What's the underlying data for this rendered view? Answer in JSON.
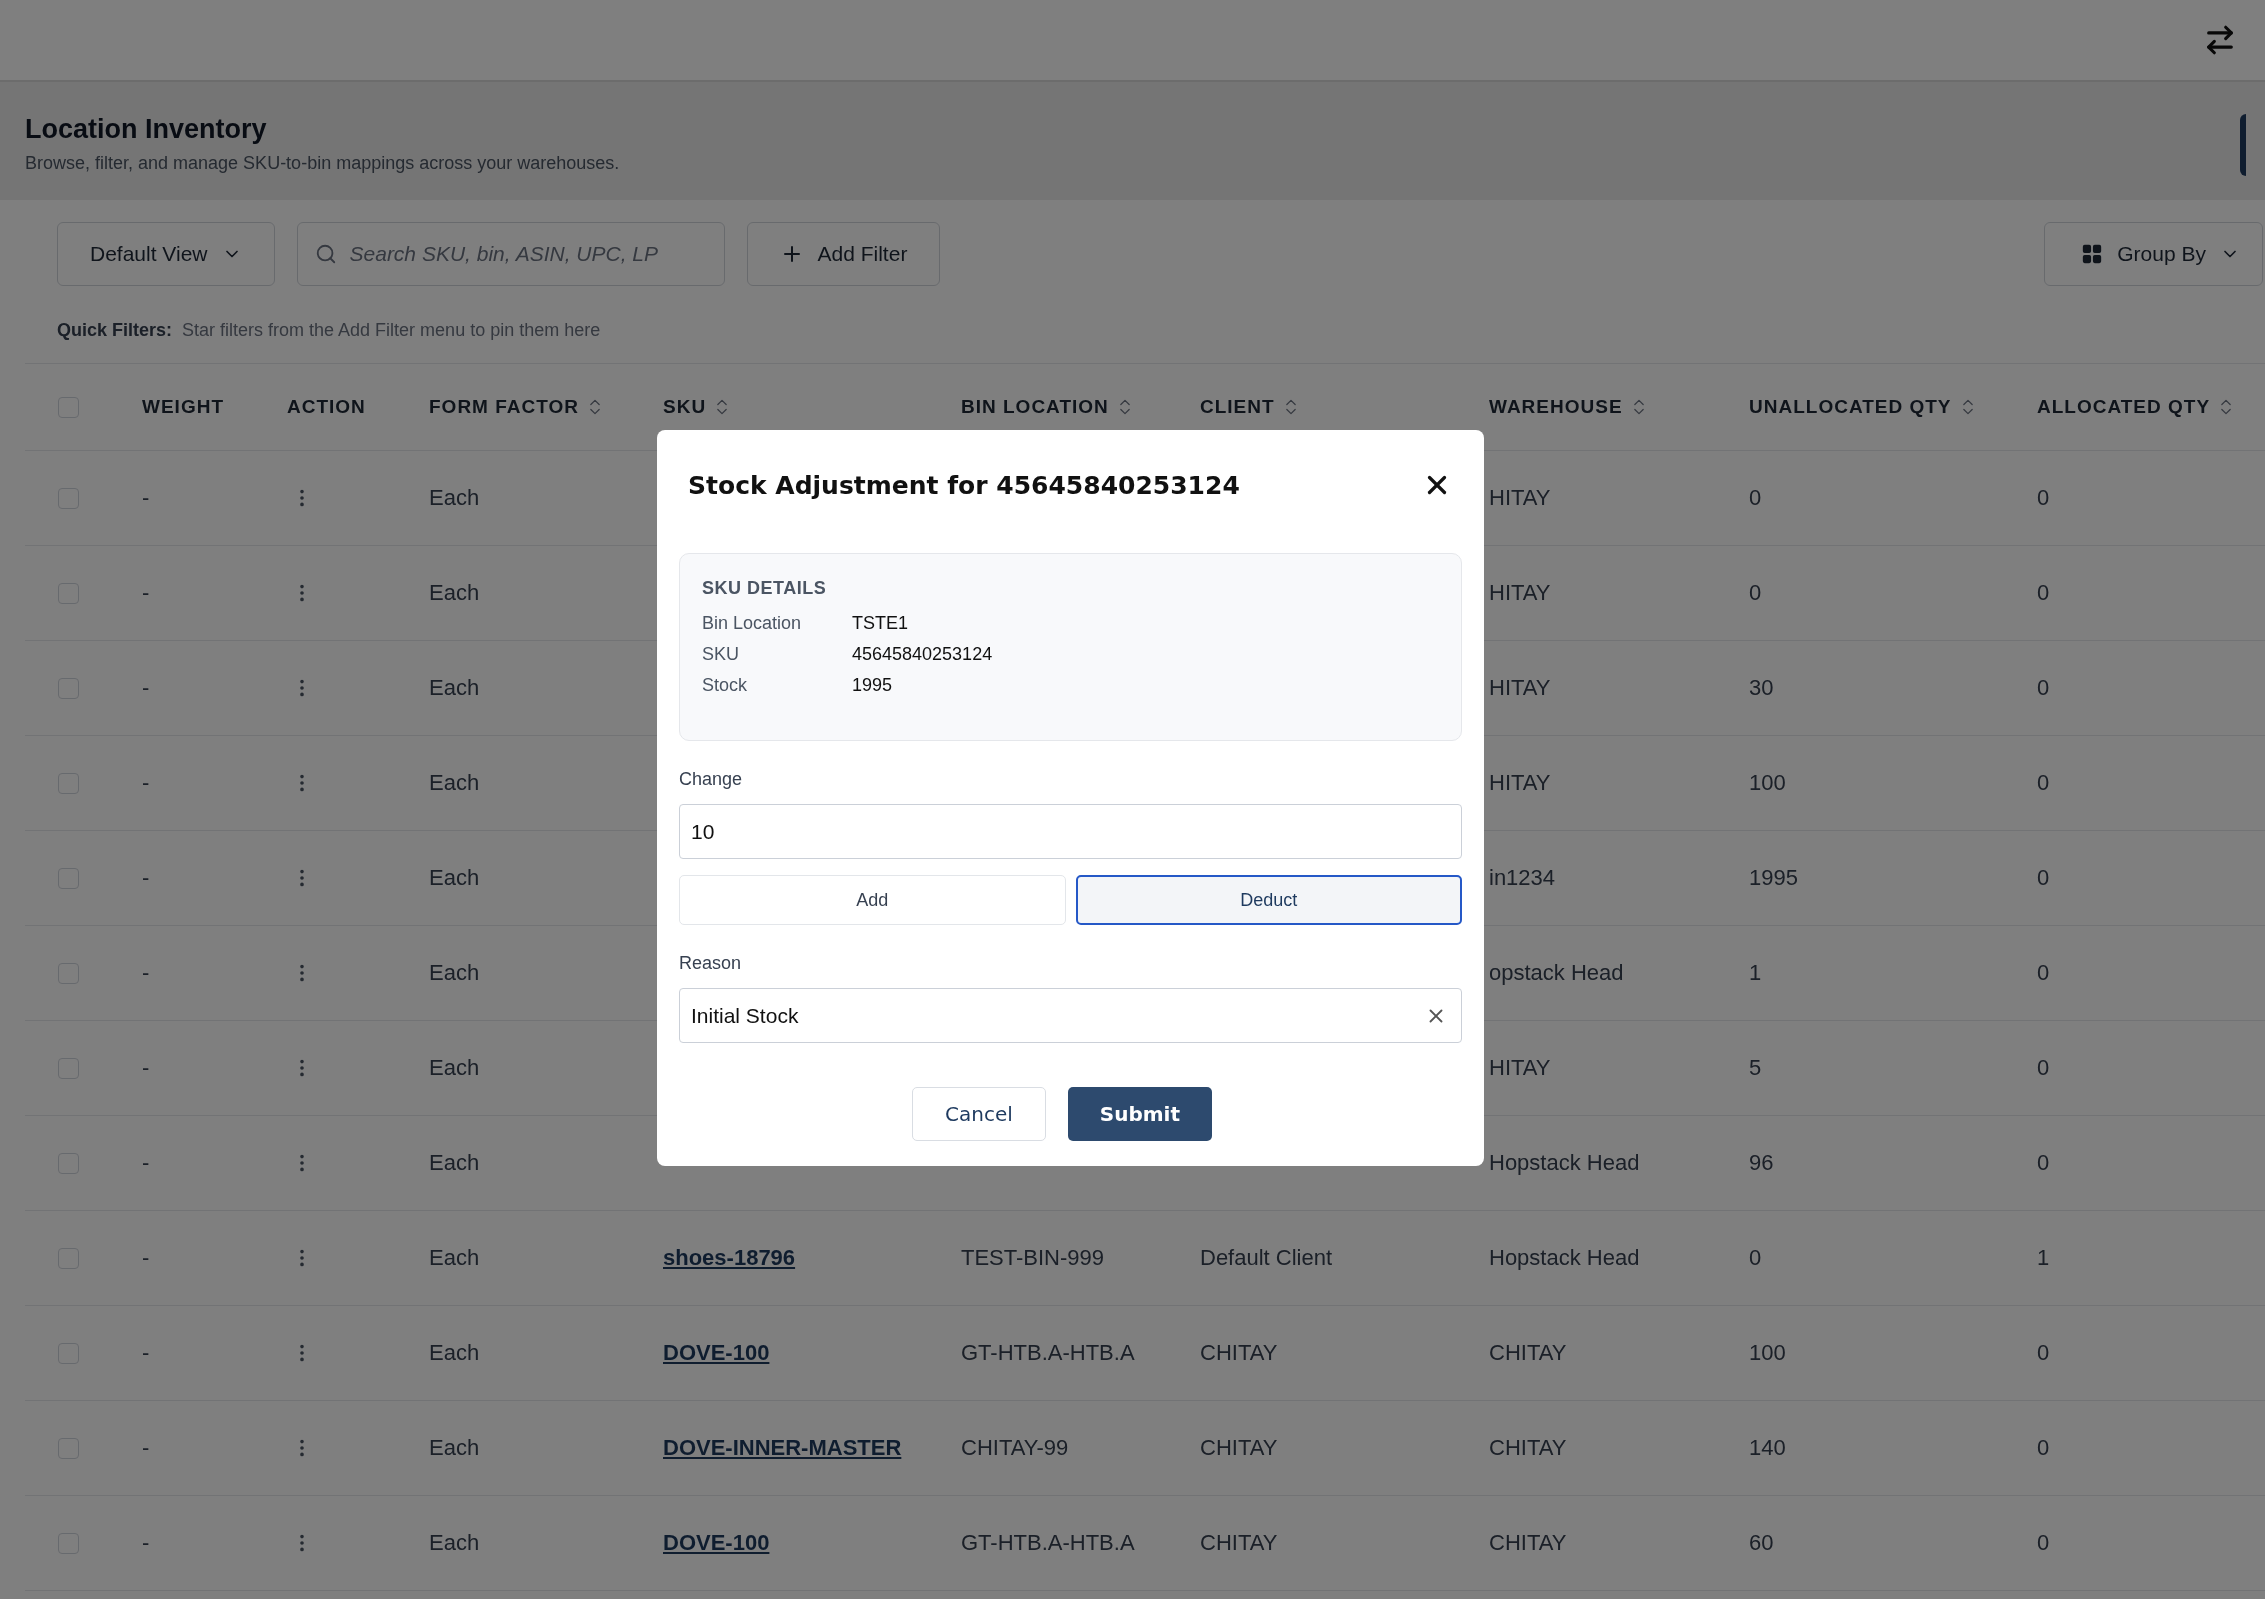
{
  "page": {
    "title": "Location Inventory",
    "subtitle": "Browse, filter, and manage SKU-to-bin mappings across your warehouses."
  },
  "toolbar": {
    "view": "Default View",
    "search_placeholder": "Search SKU, bin, ASIN, UPC, LP",
    "add_filter": "Add Filter",
    "group_by": "Group By"
  },
  "quick_filters": {
    "label": "Quick Filters:",
    "hint": "Star filters from the Add Filter menu to pin them here"
  },
  "table": {
    "header_checked": false,
    "columns": [
      {
        "kind": "text",
        "label": "WEIGHT",
        "sortable": false
      },
      {
        "kind": "action",
        "label": "ACTION",
        "sortable": false
      },
      {
        "kind": "text",
        "label": "FORM FACTOR",
        "sortable": true
      },
      {
        "kind": "link",
        "label": "SKU",
        "sortable": true
      },
      {
        "kind": "text",
        "label": "BIN LOCATION",
        "sortable": true
      },
      {
        "kind": "text",
        "label": "CLIENT",
        "sortable": true
      },
      {
        "kind": "text",
        "label": "WAREHOUSE",
        "sortable": true
      },
      {
        "kind": "text",
        "label": "UNALLOCATED QTY",
        "sortable": true
      },
      {
        "kind": "text",
        "label": "ALLOCATED QTY",
        "sortable": true
      }
    ],
    "rows": [
      {
        "checked": false,
        "cells": [
          "-",
          null,
          "Each",
          null,
          null,
          null,
          "HITAY",
          "0",
          "0"
        ]
      },
      {
        "checked": false,
        "cells": [
          "-",
          null,
          "Each",
          null,
          null,
          null,
          "HITAY",
          "0",
          "0"
        ]
      },
      {
        "checked": false,
        "cells": [
          "-",
          null,
          "Each",
          null,
          null,
          null,
          "HITAY",
          "30",
          "0"
        ]
      },
      {
        "checked": false,
        "cells": [
          "-",
          null,
          "Each",
          null,
          null,
          null,
          "HITAY",
          "100",
          "0"
        ]
      },
      {
        "checked": false,
        "cells": [
          "-",
          null,
          "Each",
          null,
          null,
          null,
          "in1234",
          "1995",
          "0"
        ]
      },
      {
        "checked": false,
        "cells": [
          "-",
          null,
          "Each",
          null,
          null,
          null,
          "opstack Head",
          "1",
          "0"
        ]
      },
      {
        "checked": false,
        "cells": [
          "-",
          null,
          "Each",
          null,
          null,
          null,
          "HITAY",
          "5",
          "0"
        ]
      },
      {
        "checked": false,
        "cells": [
          "-",
          null,
          "Each",
          null,
          null,
          null,
          "Hopstack Head",
          "96",
          "0"
        ]
      },
      {
        "checked": false,
        "cells": [
          "-",
          null,
          "Each",
          "shoes-18796",
          "TEST-BIN-999",
          "Default Client",
          "Hopstack Head",
          "0",
          "1"
        ]
      },
      {
        "checked": false,
        "cells": [
          "-",
          null,
          "Each",
          "DOVE-100",
          "GT-HTB.A-HTB.A",
          "CHITAY",
          "CHITAY",
          "100",
          "0"
        ]
      },
      {
        "checked": false,
        "cells": [
          "-",
          null,
          "Each",
          "DOVE-INNER-MASTER",
          "CHITAY-99",
          "CHITAY",
          "CHITAY",
          "140",
          "0"
        ]
      },
      {
        "checked": false,
        "cells": [
          "-",
          null,
          "Each",
          "DOVE-100",
          "GT-HTB.A-HTB.A",
          "CHITAY",
          "CHITAY",
          "60",
          "0"
        ]
      }
    ]
  },
  "modal": {
    "title": "Stock Adjustment for 45645840253124",
    "details_heading": "SKU DETAILS",
    "details": [
      {
        "label": "Bin Location",
        "value": "TSTE1"
      },
      {
        "label": "SKU",
        "value": "45645840253124"
      },
      {
        "label": "Stock",
        "value": "1995"
      }
    ],
    "change_label": "Change",
    "change_value": "10",
    "modes": [
      {
        "label": "Add",
        "selected": false
      },
      {
        "label": "Deduct",
        "selected": true
      }
    ],
    "reason_label": "Reason",
    "reason_value": "Initial Stock",
    "buttons": [
      {
        "label": "Cancel",
        "kind": "secondary"
      },
      {
        "label": "Submit",
        "kind": "primary"
      }
    ]
  }
}
